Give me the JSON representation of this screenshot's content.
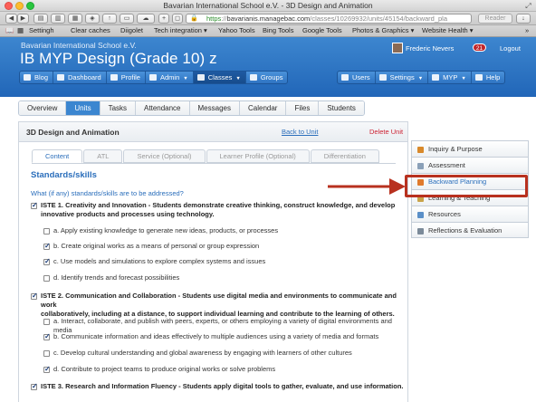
{
  "window": {
    "title": "Bavarian International School e.V. - 3D Design and Animation"
  },
  "browser": {
    "url_https": "https",
    "url_host": "bavarianis.managebac.com",
    "url_path": "/classes/10269932/units/45154/backward_pla",
    "reader": "Reader",
    "bookmarks": [
      "Settingh",
      "Clear caches",
      "Diigolet",
      "Tech integration ▾",
      "Yahoo Tools",
      "Bing Tools",
      "Google Tools",
      "Photos & Graphics ▾",
      "Website Health ▾",
      "»"
    ]
  },
  "header": {
    "school": "Bavarian International School e.V.",
    "page_title": "IB MYP Design (Grade 10) z",
    "user": "Frederic Nevers",
    "badge": "21",
    "logout": "Logout"
  },
  "nav": {
    "left": [
      {
        "label": "Blog"
      },
      {
        "label": "Dashboard"
      },
      {
        "label": "Profile"
      },
      {
        "label": "Admin"
      },
      {
        "label": "Classes"
      },
      {
        "label": "Groups"
      }
    ],
    "right": [
      {
        "label": "Users"
      },
      {
        "label": "Settings"
      },
      {
        "label": "MYP"
      },
      {
        "label": "Help"
      }
    ]
  },
  "tabs": [
    "Overview",
    "Units",
    "Tasks",
    "Attendance",
    "Messages",
    "Calendar",
    "Files",
    "Students"
  ],
  "panel": {
    "title": "3D Design and Animation",
    "back": "Back to Unit",
    "delete": "Delete Unit",
    "subtabs": [
      "Content",
      "ATL",
      "Service (Optional)",
      "Learner Profile (Optional)",
      "Differentiation"
    ],
    "heading": "Standards/skills",
    "question": "What (if any) standards/skills are to be addressed?",
    "items": [
      {
        "text": "ISTE 1. Creativity and Innovation - Students demonstrate creative thinking, construct knowledge, and develop",
        "text2": "innovative products and processes using technology.",
        "checked": true
      },
      {
        "text": "a. Apply existing knowledge to generate new ideas, products, or processes",
        "checked": false
      },
      {
        "text": "b. Create original works as a means of personal or group expression",
        "checked": true
      },
      {
        "text": "c. Use models and simulations to explore complex systems and issues",
        "checked": true
      },
      {
        "text": "d. Identify trends and forecast possibilities",
        "checked": false
      },
      {
        "text": "ISTE 2. Communication and Collaboration - Students use digital media and environments to communicate and work",
        "text2": "collaboratively, including at a distance, to support individual learning and contribute to the learning of others.",
        "checked": true
      },
      {
        "text": "a. Interact, collaborate, and publish with peers, experts, or others employing a variety of digital environments and media",
        "checked": false
      },
      {
        "text": "b. Communicate information and ideas effectively to multiple audiences using a variety of media and formats",
        "checked": true
      },
      {
        "text": "c. Develop cultural understanding and global awareness by engaging with learners of other cultures",
        "checked": false
      },
      {
        "text": "d. Contribute to project teams to produce original works or solve problems",
        "checked": true
      },
      {
        "text": "ISTE 3. Research and Information Fluency - Students apply digital tools to gather, evaluate, and use information.",
        "checked": true
      }
    ]
  },
  "sidebar": [
    {
      "label": "Inquiry & Purpose",
      "color": "#d9892b"
    },
    {
      "label": "Assessment",
      "color": "#8aa0b8"
    },
    {
      "label": "Backward Planning",
      "color": "#e07a2c"
    },
    {
      "label": "Learning & Teaching",
      "color": "#c9a44a"
    },
    {
      "label": "Resources",
      "color": "#5a8fc8"
    },
    {
      "label": "Reflections & Evaluation",
      "color": "#7b8a99"
    }
  ]
}
